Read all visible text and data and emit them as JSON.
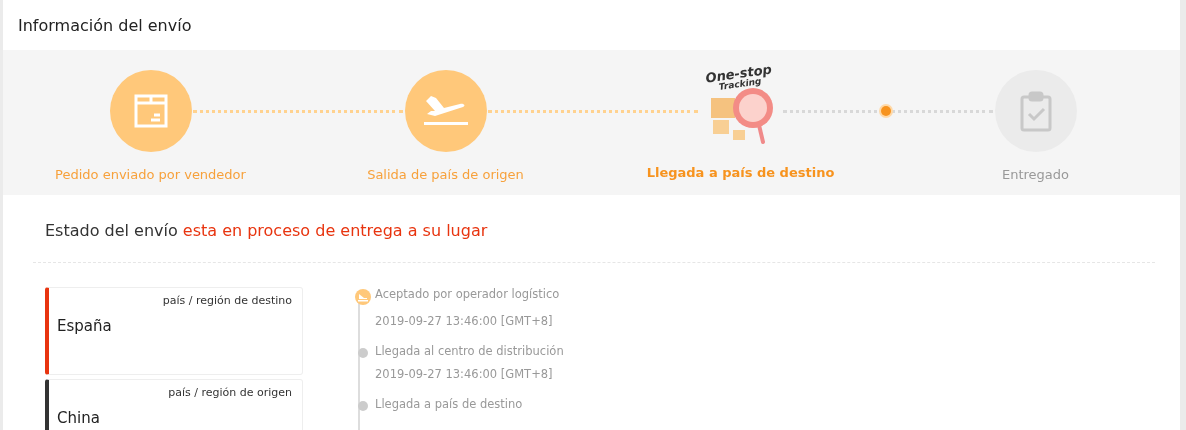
{
  "header": {
    "title": "Información del envío"
  },
  "steps": [
    {
      "label": "Pedido enviado por vendedor",
      "kind": "done"
    },
    {
      "label": "Salida de país de origen",
      "kind": "done"
    },
    {
      "label": "Llegada a país de destino",
      "kind": "current",
      "badge": [
        "One-stop",
        "Tracking"
      ]
    },
    {
      "label": "Entregado",
      "kind": "pending"
    }
  ],
  "status": {
    "prefix": "Estado del envío",
    "value": "esta en proceso de entrega a su lugar"
  },
  "regions": [
    {
      "caption": "país / región de destino",
      "country": "España",
      "color": "#e8340f"
    },
    {
      "caption": "país / región de origen",
      "country": "China",
      "color": "#333333"
    }
  ],
  "events": [
    {
      "title": "Aceptado por operador logístico",
      "time": "2019-09-27 13:46:00 [GMT+8]",
      "kind": "accepted"
    },
    {
      "title": "Llegada al centro de distribución",
      "time": "2019-09-27 13:46:00 [GMT+8]",
      "kind": "normal"
    },
    {
      "title": "Llegada a país de destino",
      "kind": "normal"
    }
  ]
}
